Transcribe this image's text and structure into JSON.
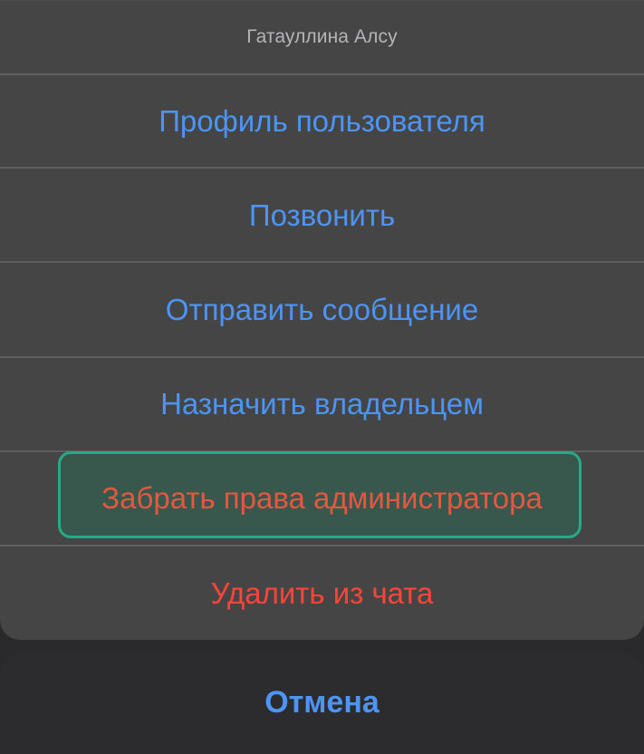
{
  "action_sheet": {
    "title": "Гатауллина Алсу",
    "actions": [
      {
        "label": "Профиль пользователя",
        "style": "default"
      },
      {
        "label": "Позвонить",
        "style": "default"
      },
      {
        "label": "Отправить сообщение",
        "style": "default"
      },
      {
        "label": "Назначить владельцем",
        "style": "default"
      },
      {
        "label": "Забрать права администратора",
        "style": "destructive",
        "highlighted": true
      },
      {
        "label": "Удалить из чата",
        "style": "destructive"
      }
    ],
    "cancel_label": "Отмена"
  },
  "colors": {
    "default_action": "#4c95f6",
    "destructive_action": "#ff453a",
    "highlight_border": "#2aa987",
    "sheet_background": "#454546",
    "cancel_background": "#2c2c2e"
  }
}
